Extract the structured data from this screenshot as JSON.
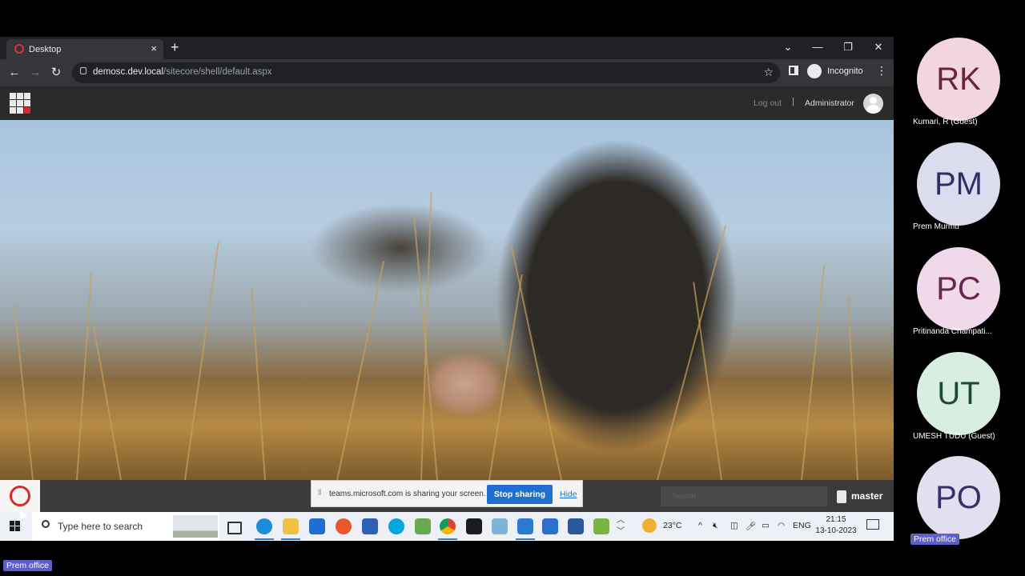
{
  "browser": {
    "tab_title": "Desktop",
    "tab_close": "×",
    "new_tab": "+",
    "window_controls": [
      "⌄",
      "—",
      "❐",
      "✕"
    ],
    "url_host": "demosc.dev.local",
    "url_path": "/sitecore/shell/default.aspx",
    "profile_label": "Incognito"
  },
  "sitecore": {
    "logout": "Log out",
    "separator": "|",
    "user": "Administrator",
    "search_placeholder": "Search",
    "database": "master"
  },
  "sharing_bar": {
    "message": "teams.microsoft.com is sharing your screen.",
    "stop_label": "Stop sharing",
    "hide_label": "Hide"
  },
  "taskbar": {
    "search_placeholder": "Type here to search",
    "weather": "23°C",
    "language": "ENG",
    "time": "21:15",
    "date": "13-10-2023"
  },
  "participants": [
    {
      "initials": "RK",
      "name": "Kumari, R (Guest)",
      "bg": "#f2d6df",
      "fg": "#6b2338"
    },
    {
      "initials": "PM",
      "name": "Prem Murmu",
      "bg": "#dcdcef",
      "fg": "#2e2e6b"
    },
    {
      "initials": "PC",
      "name": "Pritinanda Champati...",
      "bg": "#f0d9e8",
      "fg": "#6b2350"
    },
    {
      "initials": "UT",
      "name": "UMESH TUDU (Guest)",
      "bg": "#d8eee0",
      "fg": "#1e4a30"
    },
    {
      "initials": "PO",
      "name": "",
      "bg": "#e2dff0",
      "fg": "#3a2e6b"
    }
  ],
  "presenter_tag": "Prem office",
  "bottom_tag": "Prem office",
  "colors": {
    "accent_blue": "#1f6fd1",
    "sitecore_red": "#d92b2b",
    "teams_purple": "#5b5fc7"
  }
}
